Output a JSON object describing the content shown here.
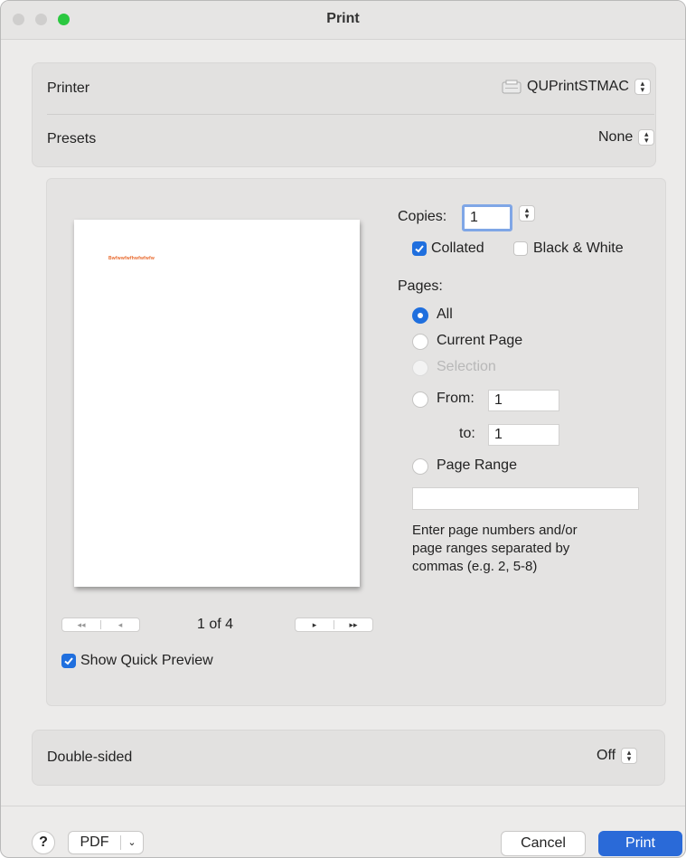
{
  "window": {
    "title": "Print"
  },
  "printer": {
    "label": "Printer",
    "value": "QUPrintSTMAC"
  },
  "presets": {
    "label": "Presets",
    "value": "None"
  },
  "preview": {
    "sample_text": "Bwfwwfwfhwfwfwfw",
    "page_indicator": "1 of 4",
    "show_quick_preview_label": "Show Quick Preview",
    "show_quick_preview_checked": true
  },
  "copies": {
    "label": "Copies:",
    "value": "1"
  },
  "collated": {
    "label": "Collated",
    "checked": true
  },
  "black_white": {
    "label": "Black & White",
    "checked": false
  },
  "pages": {
    "label": "Pages:",
    "all_label": "All",
    "current_label": "Current Page",
    "selection_label": "Selection",
    "from_label": "From:",
    "from_value": "1",
    "to_label": "to:",
    "to_value": "1",
    "range_label": "Page Range",
    "range_value": "",
    "help_line1": "Enter page numbers and/or",
    "help_line2": "page ranges separated by",
    "help_line3": "commas (e.g. 2, 5-8)",
    "selected": "All"
  },
  "double_sided": {
    "label": "Double-sided",
    "value": "Off"
  },
  "footer": {
    "help_label": "?",
    "pdf_label": "PDF",
    "cancel_label": "Cancel",
    "print_label": "Print"
  },
  "colors": {
    "accent": "#2a6ad8",
    "close": "#cfcecd",
    "minimize": "#cfcecd",
    "zoom": "#2bc840"
  }
}
